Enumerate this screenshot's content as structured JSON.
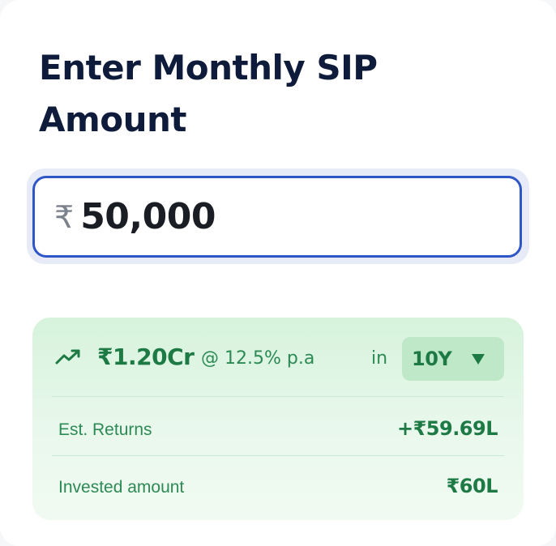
{
  "title": "Enter Monthly SIP Amount",
  "amount_input": {
    "currency_symbol": "₹",
    "value": "50,000"
  },
  "result": {
    "trend_icon": "trending-up-icon",
    "corpus": "₹1.20Cr",
    "rate": "@ 12.5% p.a",
    "in_label": "in",
    "period": {
      "selected": "10Y",
      "icon": "caret-down-icon"
    },
    "rows": [
      {
        "label": "Est. Returns",
        "value": "+₹59.69L"
      },
      {
        "label": "Invested amount",
        "value": "₹60L"
      }
    ]
  },
  "colors": {
    "title": "#0f1b3a",
    "input_border": "#2f56c7",
    "input_ring": "#e6ebf7",
    "result_bg": "#d6f3dc",
    "result_text": "#1e7a45",
    "select_bg": "#bfe8c8"
  }
}
